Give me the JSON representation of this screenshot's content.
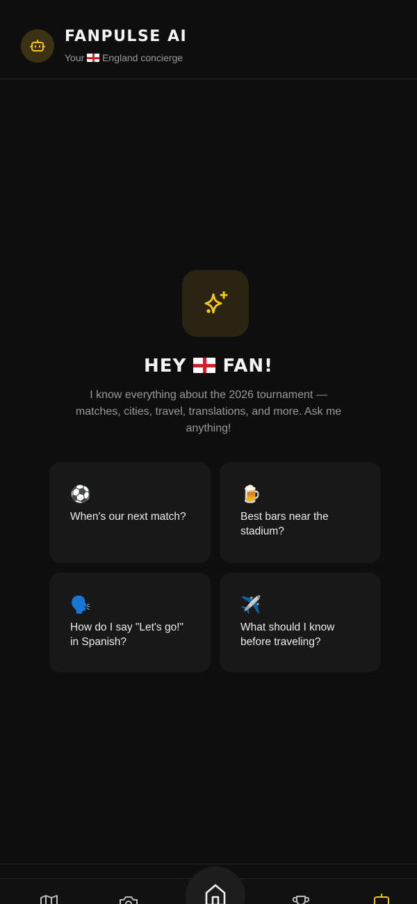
{
  "header": {
    "title": "FANPULSE AI",
    "subtitle_prefix": "Your",
    "subtitle_suffix": "England concierge"
  },
  "hero": {
    "title_prefix": "HEY",
    "title_suffix": "FAN!",
    "description": "I know everything about the 2026 tournament — matches, cities, travel, translations, and more. Ask me anything!"
  },
  "suggestions": [
    {
      "emoji": "⚽",
      "label": "When's our next match?"
    },
    {
      "emoji": "🍺",
      "label": "Best bars near the stadium?"
    },
    {
      "emoji": "🗣️",
      "label": "How do I say \"Let's go!\" in Spanish?"
    },
    {
      "emoji": "✈️",
      "label": "What should I know before traveling?"
    }
  ],
  "nav": {
    "items": [
      "map-icon",
      "camera-icon",
      "home-icon",
      "trophy-icon",
      "bot-icon"
    ],
    "active": "bot-icon"
  },
  "colors": {
    "accent": "#f5c518",
    "background": "#0e0e0e",
    "card": "#181818",
    "muted_text": "#9a9a9a"
  }
}
